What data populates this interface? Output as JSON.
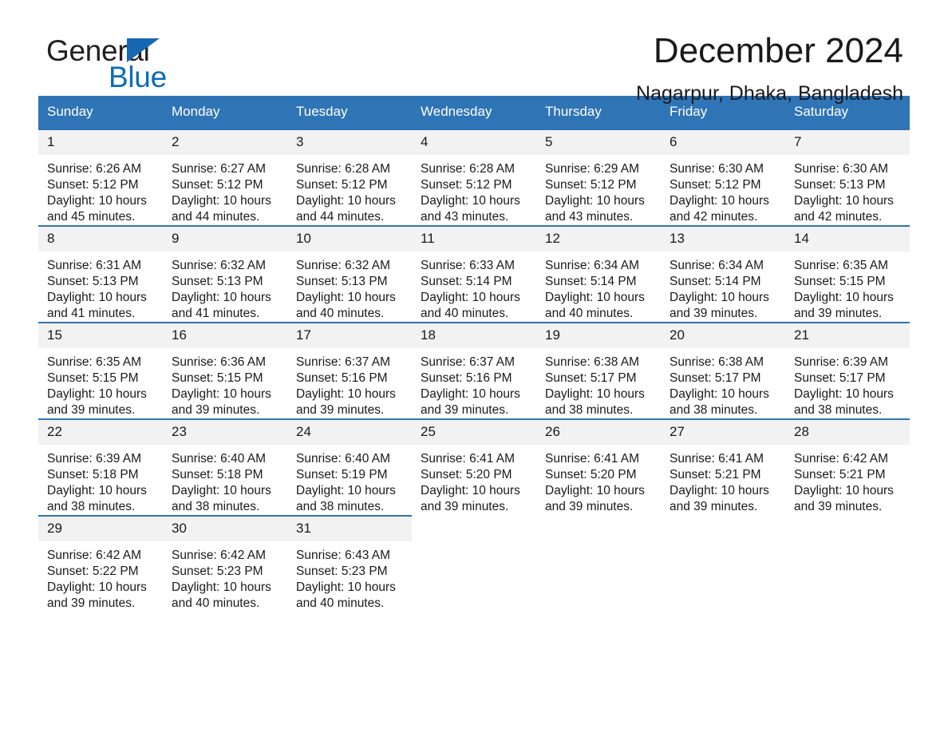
{
  "brand": {
    "word1": "General",
    "word2": "Blue",
    "triangle_color": "#1668b3",
    "blue_color": "#0c6cb7",
    "logo_icon": "triangle-flag-icon"
  },
  "header": {
    "title": "December 2024",
    "subtitle": "Nagarpur, Dhaka, Bangladesh",
    "accent_color": "#2f74b5"
  },
  "calendar": {
    "weekday_headers": [
      "Sunday",
      "Monday",
      "Tuesday",
      "Wednesday",
      "Thursday",
      "Friday",
      "Saturday"
    ],
    "weeks": [
      [
        {
          "day": "1",
          "sunrise": "Sunrise: 6:26 AM",
          "sunset": "Sunset: 5:12 PM",
          "daylight": "Daylight: 10 hours and 45 minutes."
        },
        {
          "day": "2",
          "sunrise": "Sunrise: 6:27 AM",
          "sunset": "Sunset: 5:12 PM",
          "daylight": "Daylight: 10 hours and 44 minutes."
        },
        {
          "day": "3",
          "sunrise": "Sunrise: 6:28 AM",
          "sunset": "Sunset: 5:12 PM",
          "daylight": "Daylight: 10 hours and 44 minutes."
        },
        {
          "day": "4",
          "sunrise": "Sunrise: 6:28 AM",
          "sunset": "Sunset: 5:12 PM",
          "daylight": "Daylight: 10 hours and 43 minutes."
        },
        {
          "day": "5",
          "sunrise": "Sunrise: 6:29 AM",
          "sunset": "Sunset: 5:12 PM",
          "daylight": "Daylight: 10 hours and 43 minutes."
        },
        {
          "day": "6",
          "sunrise": "Sunrise: 6:30 AM",
          "sunset": "Sunset: 5:12 PM",
          "daylight": "Daylight: 10 hours and 42 minutes."
        },
        {
          "day": "7",
          "sunrise": "Sunrise: 6:30 AM",
          "sunset": "Sunset: 5:13 PM",
          "daylight": "Daylight: 10 hours and 42 minutes."
        }
      ],
      [
        {
          "day": "8",
          "sunrise": "Sunrise: 6:31 AM",
          "sunset": "Sunset: 5:13 PM",
          "daylight": "Daylight: 10 hours and 41 minutes."
        },
        {
          "day": "9",
          "sunrise": "Sunrise: 6:32 AM",
          "sunset": "Sunset: 5:13 PM",
          "daylight": "Daylight: 10 hours and 41 minutes."
        },
        {
          "day": "10",
          "sunrise": "Sunrise: 6:32 AM",
          "sunset": "Sunset: 5:13 PM",
          "daylight": "Daylight: 10 hours and 40 minutes."
        },
        {
          "day": "11",
          "sunrise": "Sunrise: 6:33 AM",
          "sunset": "Sunset: 5:14 PM",
          "daylight": "Daylight: 10 hours and 40 minutes."
        },
        {
          "day": "12",
          "sunrise": "Sunrise: 6:34 AM",
          "sunset": "Sunset: 5:14 PM",
          "daylight": "Daylight: 10 hours and 40 minutes."
        },
        {
          "day": "13",
          "sunrise": "Sunrise: 6:34 AM",
          "sunset": "Sunset: 5:14 PM",
          "daylight": "Daylight: 10 hours and 39 minutes."
        },
        {
          "day": "14",
          "sunrise": "Sunrise: 6:35 AM",
          "sunset": "Sunset: 5:15 PM",
          "daylight": "Daylight: 10 hours and 39 minutes."
        }
      ],
      [
        {
          "day": "15",
          "sunrise": "Sunrise: 6:35 AM",
          "sunset": "Sunset: 5:15 PM",
          "daylight": "Daylight: 10 hours and 39 minutes."
        },
        {
          "day": "16",
          "sunrise": "Sunrise: 6:36 AM",
          "sunset": "Sunset: 5:15 PM",
          "daylight": "Daylight: 10 hours and 39 minutes."
        },
        {
          "day": "17",
          "sunrise": "Sunrise: 6:37 AM",
          "sunset": "Sunset: 5:16 PM",
          "daylight": "Daylight: 10 hours and 39 minutes."
        },
        {
          "day": "18",
          "sunrise": "Sunrise: 6:37 AM",
          "sunset": "Sunset: 5:16 PM",
          "daylight": "Daylight: 10 hours and 39 minutes."
        },
        {
          "day": "19",
          "sunrise": "Sunrise: 6:38 AM",
          "sunset": "Sunset: 5:17 PM",
          "daylight": "Daylight: 10 hours and 38 minutes."
        },
        {
          "day": "20",
          "sunrise": "Sunrise: 6:38 AM",
          "sunset": "Sunset: 5:17 PM",
          "daylight": "Daylight: 10 hours and 38 minutes."
        },
        {
          "day": "21",
          "sunrise": "Sunrise: 6:39 AM",
          "sunset": "Sunset: 5:17 PM",
          "daylight": "Daylight: 10 hours and 38 minutes."
        }
      ],
      [
        {
          "day": "22",
          "sunrise": "Sunrise: 6:39 AM",
          "sunset": "Sunset: 5:18 PM",
          "daylight": "Daylight: 10 hours and 38 minutes."
        },
        {
          "day": "23",
          "sunrise": "Sunrise: 6:40 AM",
          "sunset": "Sunset: 5:18 PM",
          "daylight": "Daylight: 10 hours and 38 minutes."
        },
        {
          "day": "24",
          "sunrise": "Sunrise: 6:40 AM",
          "sunset": "Sunset: 5:19 PM",
          "daylight": "Daylight: 10 hours and 38 minutes."
        },
        {
          "day": "25",
          "sunrise": "Sunrise: 6:41 AM",
          "sunset": "Sunset: 5:20 PM",
          "daylight": "Daylight: 10 hours and 39 minutes."
        },
        {
          "day": "26",
          "sunrise": "Sunrise: 6:41 AM",
          "sunset": "Sunset: 5:20 PM",
          "daylight": "Daylight: 10 hours and 39 minutes."
        },
        {
          "day": "27",
          "sunrise": "Sunrise: 6:41 AM",
          "sunset": "Sunset: 5:21 PM",
          "daylight": "Daylight: 10 hours and 39 minutes."
        },
        {
          "day": "28",
          "sunrise": "Sunrise: 6:42 AM",
          "sunset": "Sunset: 5:21 PM",
          "daylight": "Daylight: 10 hours and 39 minutes."
        }
      ],
      [
        {
          "day": "29",
          "sunrise": "Sunrise: 6:42 AM",
          "sunset": "Sunset: 5:22 PM",
          "daylight": "Daylight: 10 hours and 39 minutes."
        },
        {
          "day": "30",
          "sunrise": "Sunrise: 6:42 AM",
          "sunset": "Sunset: 5:23 PM",
          "daylight": "Daylight: 10 hours and 40 minutes."
        },
        {
          "day": "31",
          "sunrise": "Sunrise: 6:43 AM",
          "sunset": "Sunset: 5:23 PM",
          "daylight": "Daylight: 10 hours and 40 minutes."
        },
        null,
        null,
        null,
        null
      ]
    ]
  }
}
